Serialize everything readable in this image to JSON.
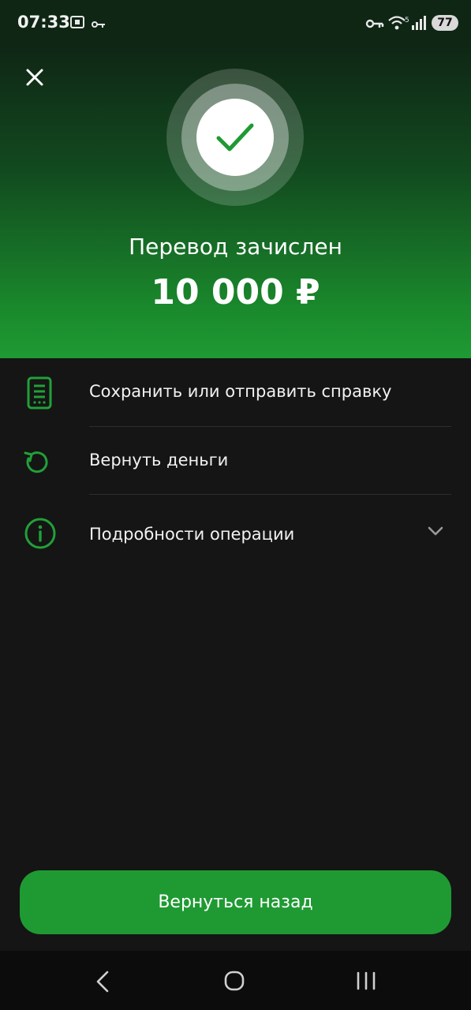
{
  "status_bar": {
    "time": "07:33",
    "battery": "77"
  },
  "hero": {
    "title": "Перевод зачислен",
    "amount": "10 000 ₽"
  },
  "actions": [
    {
      "label": "Сохранить или отправить справку",
      "icon": "document-icon"
    },
    {
      "label": "Вернуть деньги",
      "icon": "refund-icon"
    },
    {
      "label": "Подробности операции",
      "icon": "info-icon"
    }
  ],
  "footer": {
    "back_label": "Вернуться назад"
  },
  "colors": {
    "accent": "#1f9a33",
    "icon_green": "#21a038",
    "background": "#151515"
  }
}
